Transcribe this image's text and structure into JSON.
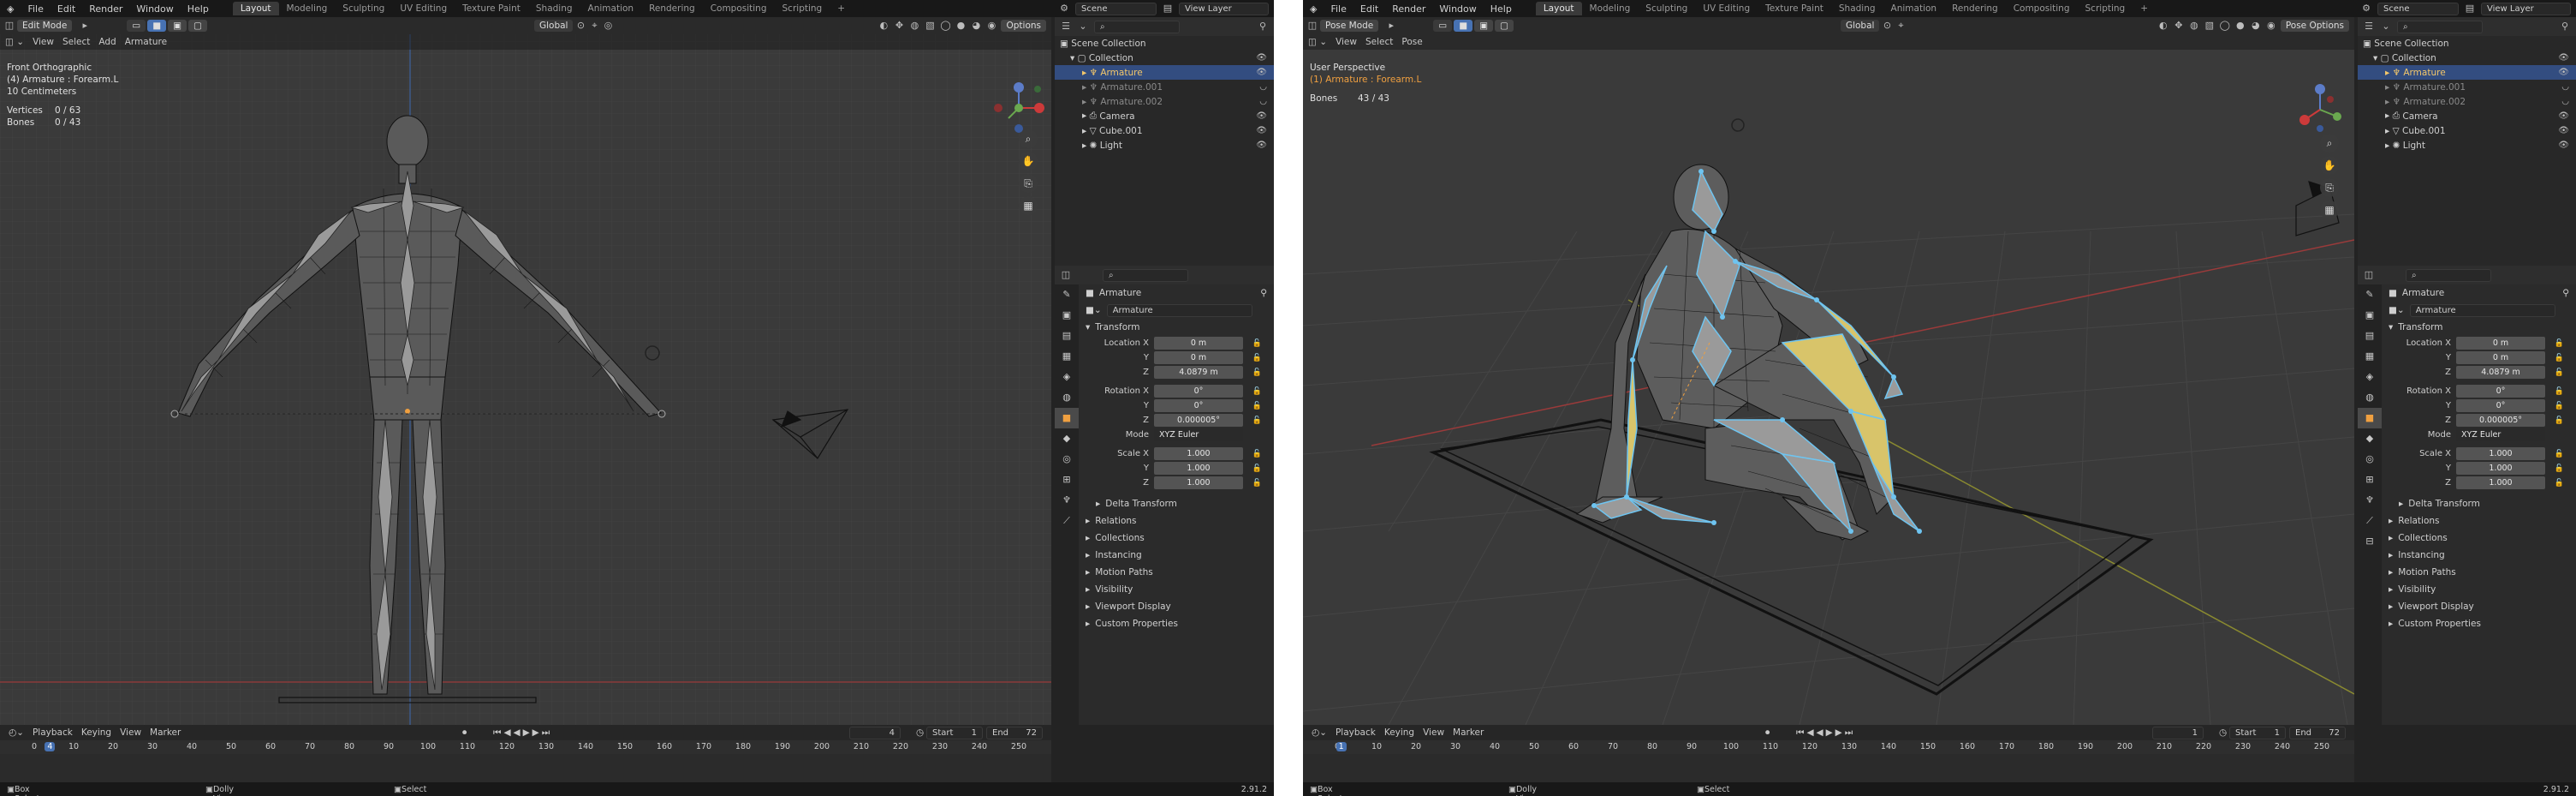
{
  "menu": [
    "File",
    "Edit",
    "Render",
    "Window",
    "Help"
  ],
  "workspaces": [
    "Layout",
    "Modeling",
    "Sculpting",
    "UV Editing",
    "Texture Paint",
    "Shading",
    "Animation",
    "Rendering",
    "Compositing",
    "Scripting"
  ],
  "scene_name": "Scene",
  "view_layer": "View Layer",
  "left": {
    "mode": "Edit Mode",
    "header_menus": [
      "View",
      "Select",
      "Add",
      "Armature"
    ],
    "orientation": "Global",
    "options": "Options",
    "overlay": {
      "view": "Front Orthographic",
      "object": "(4) Armature : Forearm.L",
      "scale": "10 Centimeters",
      "stat1_label": "Vertices",
      "stat1_value": "0 / 63",
      "stat2_label": "Bones",
      "stat2_value": "0 / 43"
    },
    "current_frame": "4",
    "ruler_current": "4"
  },
  "right": {
    "mode": "Pose Mode",
    "header_menus": [
      "View",
      "Select",
      "Pose"
    ],
    "orientation": "Global",
    "options": "Pose Options",
    "overlay": {
      "view": "User Perspective",
      "object": "(1) Armature : Forearm.L",
      "stat2_label": "Bones",
      "stat2_value": "43 / 43"
    },
    "current_frame": "1",
    "ruler_current": "1"
  },
  "outliner": {
    "title": "Scene Collection",
    "items": [
      {
        "label": "Collection",
        "kind": "collection"
      },
      {
        "label": "Armature",
        "kind": "selected"
      },
      {
        "label": "Armature.001",
        "kind": "sub"
      },
      {
        "label": "Armature.002",
        "kind": "sub"
      },
      {
        "label": "Camera",
        "kind": "normal"
      },
      {
        "label": "Cube.001",
        "kind": "normal"
      },
      {
        "label": "Light",
        "kind": "normal"
      }
    ]
  },
  "properties": {
    "object_label": "Armature",
    "name_field": "Armature",
    "transform_title": "Transform",
    "location": [
      {
        "label": "Location X",
        "value": "0 m"
      },
      {
        "label": "Y",
        "value": "0 m"
      },
      {
        "label": "Z",
        "value": "4.0879 m"
      }
    ],
    "rotation": [
      {
        "label": "Rotation X",
        "value": "0°"
      },
      {
        "label": "Y",
        "value": "0°"
      },
      {
        "label": "Z",
        "value": "0.000005°"
      }
    ],
    "mode_label": "Mode",
    "mode_value": "XYZ Euler",
    "scale": [
      {
        "label": "Scale X",
        "value": "1.000"
      },
      {
        "label": "Y",
        "value": "1.000"
      },
      {
        "label": "Z",
        "value": "1.000"
      }
    ],
    "delta": "Delta Transform",
    "sections": [
      "Relations",
      "Collections",
      "Instancing",
      "Motion Paths",
      "Visibility",
      "Viewport Display",
      "Custom Properties"
    ]
  },
  "timeline": {
    "menus": [
      "Playback",
      "Keying",
      "View",
      "Marker"
    ],
    "start_label": "Start",
    "start_value": "1",
    "end_label": "End",
    "end_value": "72",
    "ticks": [
      "0",
      "10",
      "20",
      "30",
      "40",
      "50",
      "60",
      "70",
      "80",
      "90",
      "100",
      "110",
      "120",
      "130",
      "140",
      "150",
      "160",
      "170",
      "180",
      "190",
      "200",
      "210",
      "220",
      "230",
      "240",
      "250"
    ]
  },
  "status": {
    "left": "Box Select",
    "mid": "Dolly View",
    "right": "Select",
    "version": "2.91.2"
  },
  "colors": {
    "accent": "#4772b3",
    "selected_text": "#f4c86a",
    "bone_blue": "#6ec4f0",
    "bone_yellow": "#d8c46a"
  }
}
